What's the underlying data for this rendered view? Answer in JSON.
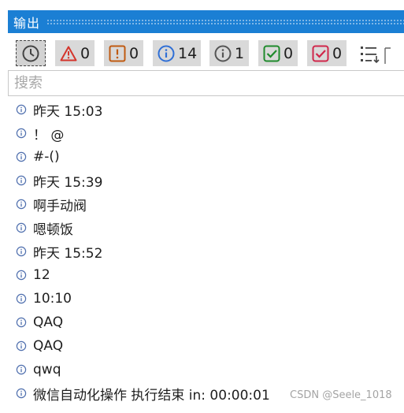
{
  "panel": {
    "title": "输出"
  },
  "toolbar": {
    "filters": [
      {
        "name": "clock",
        "count": ""
      },
      {
        "name": "error",
        "count": "0"
      },
      {
        "name": "warning",
        "count": "0"
      },
      {
        "name": "info",
        "count": "14"
      },
      {
        "name": "debug",
        "count": "1"
      },
      {
        "name": "success",
        "count": "0"
      },
      {
        "name": "failure",
        "count": "0"
      }
    ]
  },
  "search": {
    "placeholder": "搜索",
    "value": ""
  },
  "log": [
    "昨天 15:03",
    "！ @",
    "#-()",
    "昨天 15:39",
    "啊手动阀",
    "嗯顿饭",
    "昨天 15:52",
    "12",
    "10:10",
    "QAQ",
    "QAQ",
    "qwq",
    "微信自动化操作 执行结束 in: 00:00:01"
  ],
  "watermark": "CSDN @Seele_1018",
  "colors": {
    "titlebar": "#1b7fd4",
    "error": "#d4342b",
    "warning": "#c05a11",
    "info": "#2f6fd6",
    "success": "#1f8a2c",
    "failure": "#d0264a"
  }
}
